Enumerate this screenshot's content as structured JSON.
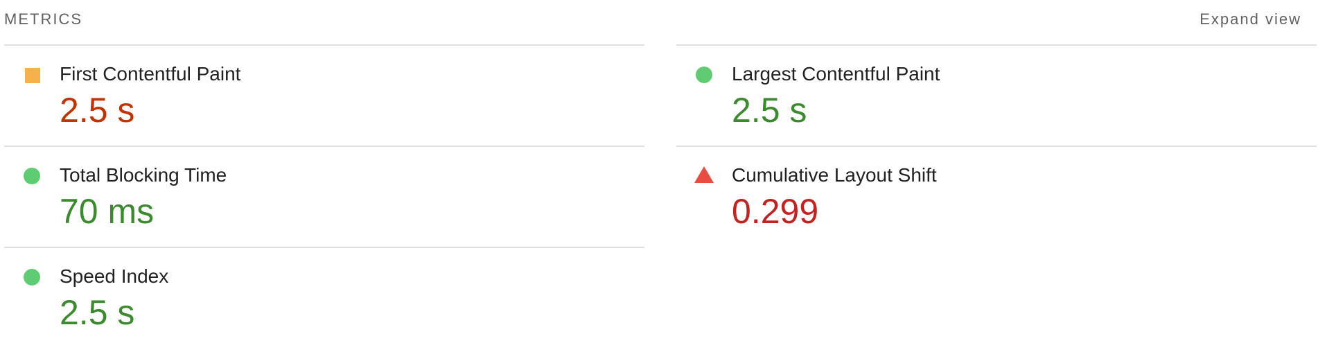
{
  "header": {
    "title": "METRICS",
    "expand_label": "Expand view"
  },
  "colors": {
    "pass": "#3b8a2e",
    "average": "#c33300",
    "fail": "#c5221f",
    "pass_icon": "#5fcc73",
    "average_icon": "#f4b14c",
    "fail_icon": "#eb4c41",
    "divider": "#e0e0e0"
  },
  "metrics": {
    "fcp": {
      "label": "First Contentful Paint",
      "value": "2.5 s",
      "rating": "average",
      "icon": "orange-square-icon"
    },
    "lcp": {
      "label": "Largest Contentful Paint",
      "value": "2.5 s",
      "rating": "pass",
      "icon": "green-circle-icon"
    },
    "tbt": {
      "label": "Total Blocking Time",
      "value": "70 ms",
      "rating": "pass",
      "icon": "green-circle-icon"
    },
    "cls": {
      "label": "Cumulative Layout Shift",
      "value": "0.299",
      "rating": "fail",
      "icon": "red-triangle-icon"
    },
    "si": {
      "label": "Speed Index",
      "value": "2.5 s",
      "rating": "pass",
      "icon": "green-circle-icon"
    }
  }
}
